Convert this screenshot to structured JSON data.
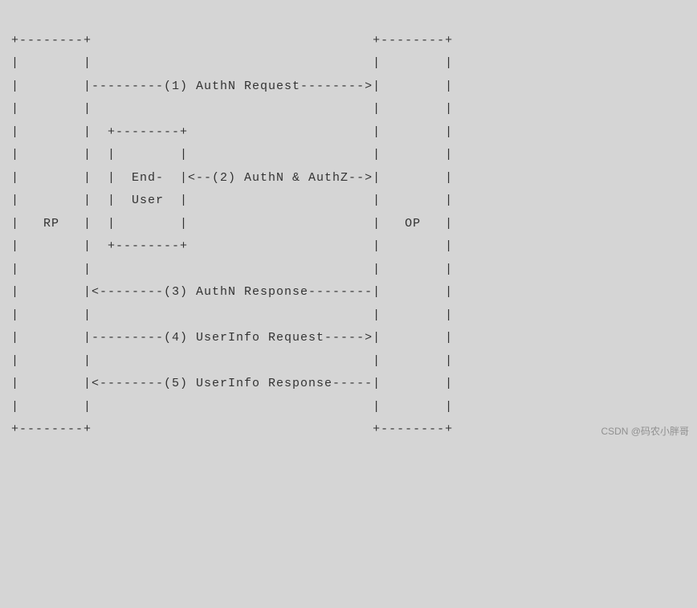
{
  "left_box_label": "RP",
  "right_box_label": "OP",
  "inner_box_line1": "End-",
  "inner_box_line2": "User",
  "steps": {
    "s1": "(1) AuthN Request",
    "s2": "(2) AuthN & AuthZ",
    "s3": "(3) AuthN Response",
    "s4": "(4) UserInfo Request",
    "s5": "(5) UserInfo Response"
  },
  "watermark": "CSDN @码农小胖哥",
  "ascii_lines": [
    "+--------+                                   +--------+",
    "|        |                                   |        |",
    "|        |---------(1) AuthN Request-------->|        |",
    "|        |                                   |        |",
    "|        |  +--------+                       |        |",
    "|        |  |        |                       |        |",
    "|        |  |  End-  |<--(2) AuthN & AuthZ-->|        |",
    "|        |  |  User  |                       |        |",
    "|   RP   |  |        |                       |   OP   |",
    "|        |  +--------+                       |        |",
    "|        |                                   |        |",
    "|        |<--------(3) AuthN Response--------|        |",
    "|        |                                   |        |",
    "|        |---------(4) UserInfo Request----->|        |",
    "|        |                                   |        |",
    "|        |<--------(5) UserInfo Response-----|        |",
    "|        |                                   |        |",
    "+--------+                                   +--------+"
  ],
  "chart_data": {
    "type": "table",
    "title": "OpenID Connect abstract protocol flow",
    "participants": [
      "RP",
      "End-User",
      "OP"
    ],
    "messages": [
      {
        "step": 1,
        "from": "RP",
        "to": "OP",
        "label": "AuthN Request",
        "direction": "->"
      },
      {
        "step": 2,
        "from": "OP",
        "to": "End-User",
        "label": "AuthN & AuthZ",
        "direction": "<->"
      },
      {
        "step": 3,
        "from": "OP",
        "to": "RP",
        "label": "AuthN Response",
        "direction": "->"
      },
      {
        "step": 4,
        "from": "RP",
        "to": "OP",
        "label": "UserInfo Request",
        "direction": "->"
      },
      {
        "step": 5,
        "from": "OP",
        "to": "RP",
        "label": "UserInfo Response",
        "direction": "->"
      }
    ]
  }
}
